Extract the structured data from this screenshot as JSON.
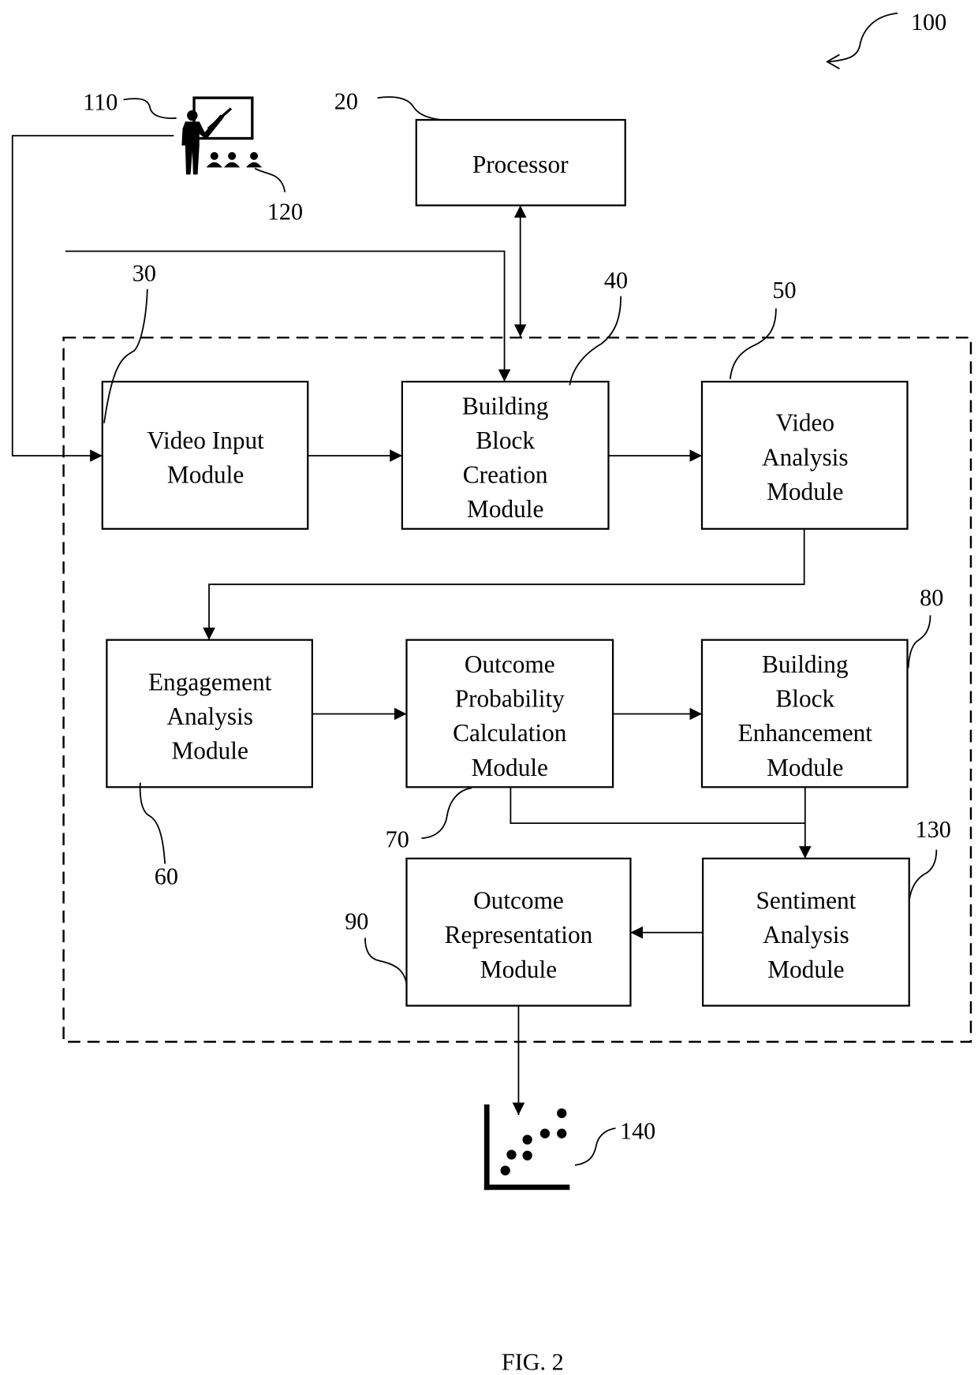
{
  "figure": {
    "caption": "FIG. 2",
    "system_ref": "100"
  },
  "processor": {
    "ref": "20",
    "label": "Processor"
  },
  "presenter_icon": {
    "ref": "110",
    "name": "presenter-at-board-icon"
  },
  "audience_icon": {
    "ref": "120",
    "name": "audience-icon"
  },
  "modules": [
    {
      "id": "video-input",
      "ref": "30",
      "lines": [
        "Video Input",
        "Module"
      ]
    },
    {
      "id": "building-block-creation",
      "ref": "40",
      "lines": [
        "Building",
        "Block",
        "Creation",
        "Module"
      ]
    },
    {
      "id": "video-analysis",
      "ref": "50",
      "lines": [
        "Video",
        "Analysis",
        "Module"
      ]
    },
    {
      "id": "engagement-analysis",
      "ref": "60",
      "lines": [
        "Engagement",
        "Analysis",
        "Module"
      ]
    },
    {
      "id": "outcome-probability-calculation",
      "ref": "70",
      "lines": [
        "Outcome",
        "Probability",
        "Calculation",
        "Module"
      ]
    },
    {
      "id": "building-block-enhancement",
      "ref": "80",
      "lines": [
        "Building",
        "Block",
        "Enhancement",
        "Module"
      ]
    },
    {
      "id": "outcome-representation",
      "ref": "90",
      "lines": [
        "Outcome",
        "Representation",
        "Module"
      ]
    },
    {
      "id": "sentiment-analysis",
      "ref": "130",
      "lines": [
        "Sentiment",
        "Analysis",
        "Module"
      ]
    }
  ],
  "output_icon": {
    "ref": "140",
    "name": "scatter-plot-icon"
  },
  "connections": [
    {
      "from": "presenter",
      "to": "video-input"
    },
    {
      "from": "external-input",
      "to": "building-block-creation"
    },
    {
      "from": "processor",
      "to": "building-block-creation",
      "bidirectional": true
    },
    {
      "from": "video-input",
      "to": "building-block-creation"
    },
    {
      "from": "building-block-creation",
      "to": "video-analysis"
    },
    {
      "from": "video-analysis",
      "to": "engagement-analysis"
    },
    {
      "from": "engagement-analysis",
      "to": "outcome-probability-calculation"
    },
    {
      "from": "outcome-probability-calculation",
      "to": "building-block-enhancement"
    },
    {
      "from": "outcome-probability-calculation",
      "to": "sentiment-analysis"
    },
    {
      "from": "building-block-enhancement",
      "to": "sentiment-analysis"
    },
    {
      "from": "sentiment-analysis",
      "to": "outcome-representation"
    },
    {
      "from": "outcome-representation",
      "to": "output-plot"
    }
  ]
}
